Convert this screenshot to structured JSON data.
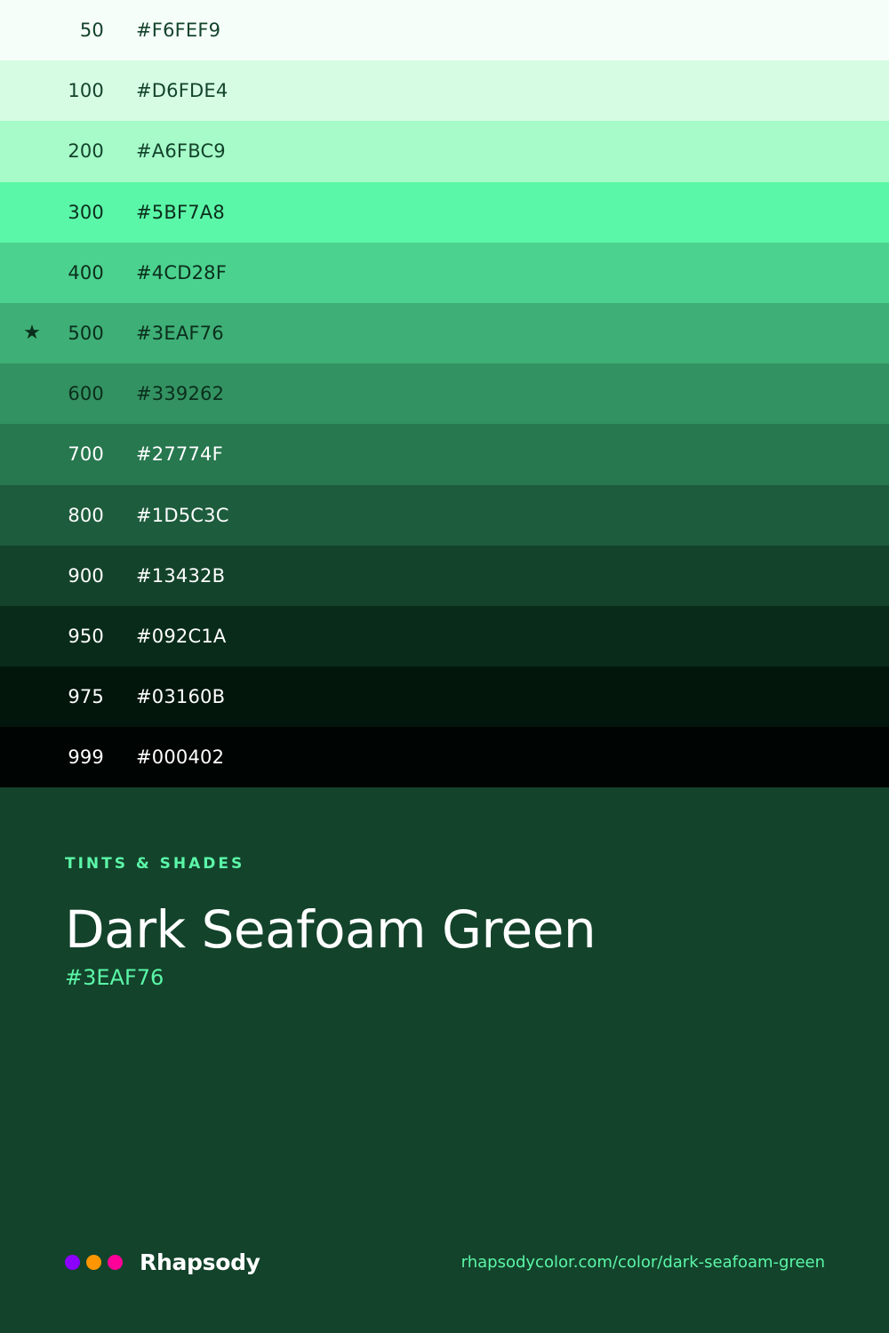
{
  "palette": [
    {
      "step": "50",
      "hex": "#F6FEF9",
      "text": "#13432B",
      "star": ""
    },
    {
      "step": "100",
      "hex": "#D6FDE4",
      "text": "#13432B",
      "star": ""
    },
    {
      "step": "200",
      "hex": "#A6FBC9",
      "text": "#13432B",
      "star": ""
    },
    {
      "step": "300",
      "hex": "#5BF7A8",
      "text": "#0B2E1C",
      "star": ""
    },
    {
      "step": "400",
      "hex": "#4CD28F",
      "text": "#0B2E1C",
      "star": ""
    },
    {
      "step": "500",
      "hex": "#3EAF76",
      "text": "#0B2E1C",
      "star": "★"
    },
    {
      "step": "600",
      "hex": "#339262",
      "text": "#0B2E1C",
      "star": ""
    },
    {
      "step": "700",
      "hex": "#27774F",
      "text": "#FFFFFF",
      "star": ""
    },
    {
      "step": "800",
      "hex": "#1D5C3C",
      "text": "#FFFFFF",
      "star": ""
    },
    {
      "step": "900",
      "hex": "#13432B",
      "text": "#FFFFFF",
      "star": ""
    },
    {
      "step": "950",
      "hex": "#092C1A",
      "text": "#FFFFFF",
      "star": ""
    },
    {
      "step": "975",
      "hex": "#03160B",
      "text": "#FFFFFF",
      "star": ""
    },
    {
      "step": "999",
      "hex": "#000402",
      "text": "#FFFFFF",
      "star": ""
    }
  ],
  "info": {
    "eyebrow": "TINTS & SHADES",
    "title": "Dark Seafoam Green",
    "hex": "#3EAF76"
  },
  "footer": {
    "brand_name": "Rhapsody",
    "brand_dots": [
      "#8C00FF",
      "#FF9500",
      "#FF0099"
    ],
    "url": "rhapsodycolor.com/color/dark-seafoam-green"
  },
  "colors": {
    "background": "#13432B",
    "accent": "#5BF7A8"
  }
}
